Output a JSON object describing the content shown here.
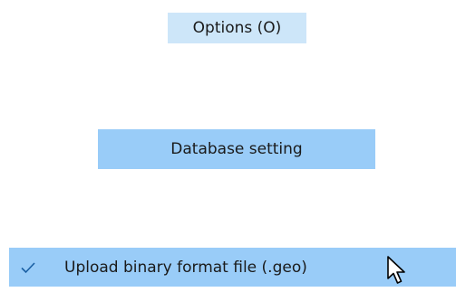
{
  "options_item": {
    "label": "Options (O)"
  },
  "database_item": {
    "label": "Database setting"
  },
  "upload_item": {
    "label": "Upload binary format file (.geo)",
    "checked": true,
    "check_icon": "checkmark-icon"
  },
  "cursor": {
    "icon": "mouse-pointer-icon"
  },
  "colors": {
    "hover": "#cde6f9",
    "selected": "#99ccf8",
    "check": "#1a5fa3"
  }
}
